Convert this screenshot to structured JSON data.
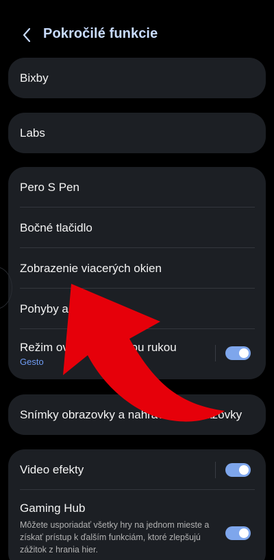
{
  "header": {
    "back_icon": "chevron-left-icon",
    "title": "Pokročilé funkcie"
  },
  "cards": {
    "bixby": {
      "label": "Bixby"
    },
    "labs": {
      "label": "Labs"
    },
    "main": {
      "items": [
        {
          "label": "Pero S Pen"
        },
        {
          "label": "Bočné tlačidlo"
        },
        {
          "label": "Zobrazenie viacerých okien"
        },
        {
          "label": "Pohyby a gestá"
        },
        {
          "label": "Režim ovládania jednou rukou",
          "sublabel": "Gesto",
          "toggle": "on"
        }
      ]
    },
    "screenshots": {
      "label": "Snímky obrazovky a nahrávanie obrazovky"
    },
    "bottom": {
      "video_effects": {
        "label": "Video efekty",
        "toggle": "on"
      },
      "gaming_hub": {
        "label": "Gaming Hub",
        "description": "Môžete usporiadať všetky hry na jednom mieste a získať prístup k ďalším funkciám, ktoré zlepšujú zážitok z hrania hier.",
        "toggle": "on"
      }
    }
  },
  "colors": {
    "background": "#000000",
    "card": "#1c1f24",
    "title": "#c9dcff",
    "accent": "#6f9cf4",
    "toggle_on": "#7ea6ec",
    "arrow": "#e6000a"
  },
  "overlay": {
    "icon": "red-curved-arrow-icon"
  }
}
